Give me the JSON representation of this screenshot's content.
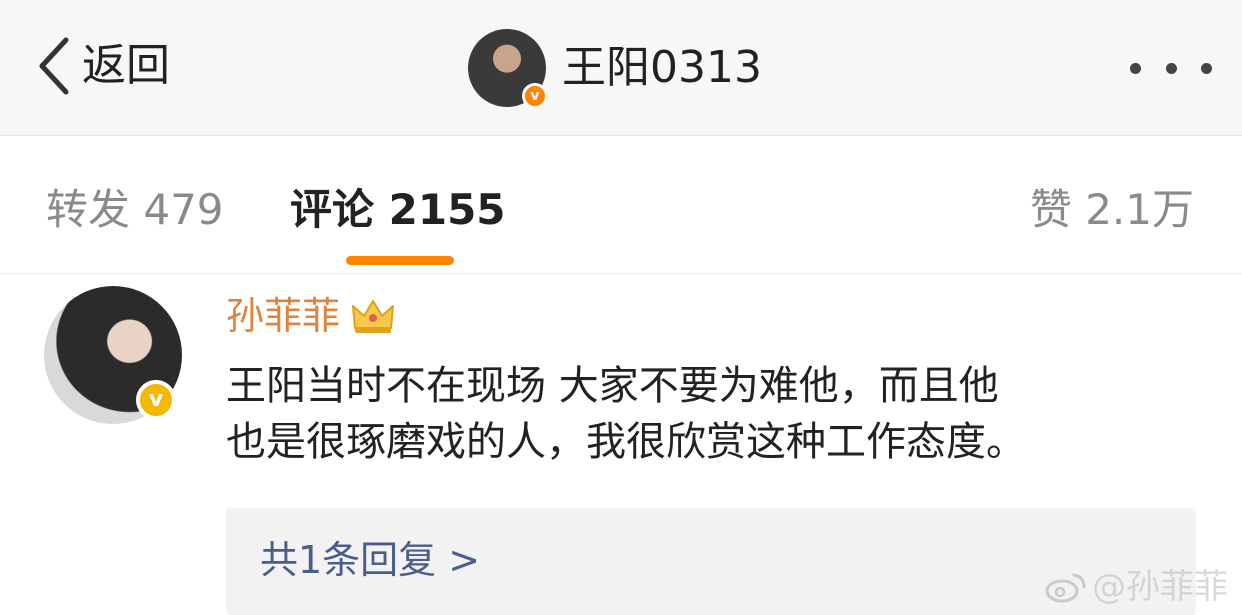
{
  "nav": {
    "back_label": "返回",
    "back_icon": "chevron-left-icon",
    "user_name": "王阳0313",
    "verified_icon": "verified-badge-icon",
    "more_icon": "more-dots-icon"
  },
  "tabs": {
    "repost": "转发 479",
    "comment": "评论 2155",
    "like": "赞 2.1万",
    "active": "comment"
  },
  "comment": {
    "author": "孙菲菲",
    "author_badge_icon": "crown-icon",
    "line1": "王阳当时不在现场 大家不要为难他，而且他",
    "line2": "也是很琢磨戏的人，我很欣赏这种工作态度。",
    "replies_label": "共1条回复 >"
  },
  "watermark": {
    "text": "@孙菲菲",
    "icon": "weibo-logo-icon"
  },
  "colors": {
    "accent": "#ff8200",
    "author_name": "#e0833b",
    "reply_link": "#4a5d8c",
    "nav_bg": "#f7f7f7"
  }
}
